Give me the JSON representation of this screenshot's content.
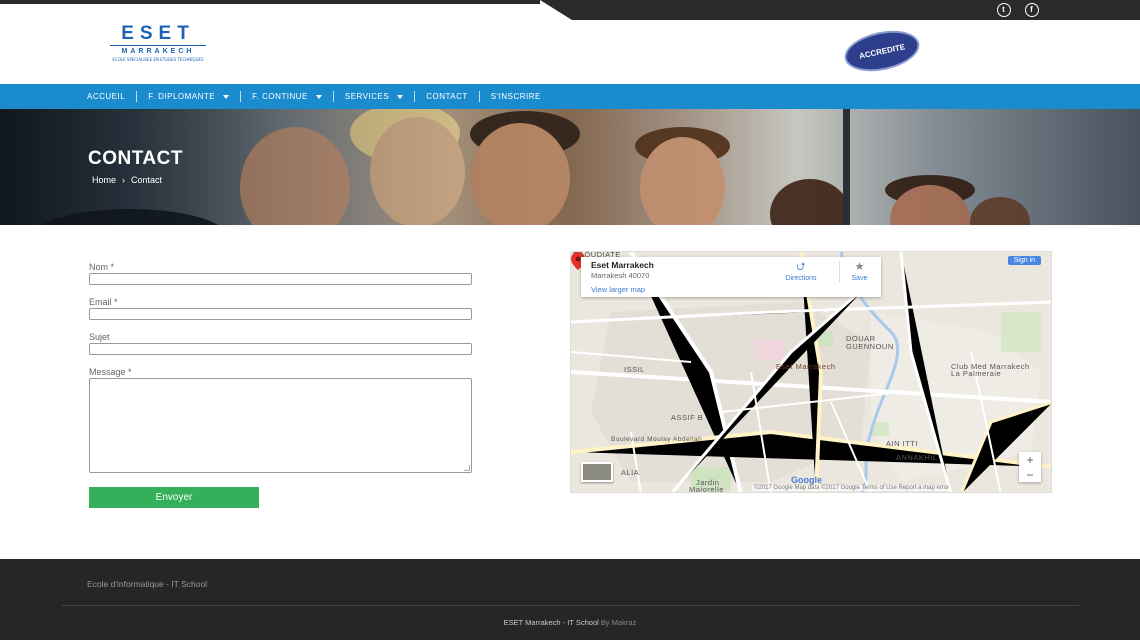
{
  "social": {
    "twitter": "twitter-icon",
    "facebook": "facebook-icon",
    "twitter_glyph": "t",
    "facebook_glyph": "f"
  },
  "header": {
    "logo_title": "ESET",
    "logo_sub": "MARRAKECH",
    "logo_tagline": "ECOLE SPECIALISEE EN ETUDES TECHNIQUES",
    "badge_text": "ACCREDITE"
  },
  "nav": {
    "items": [
      {
        "label": "ACCUEIL"
      },
      {
        "label": "F. DIPLOMANTE"
      },
      {
        "label": "F. CONTINUE"
      },
      {
        "label": "SERVICES"
      },
      {
        "label": "CONTACT"
      },
      {
        "label": "S'INSCRIRE"
      }
    ]
  },
  "hero": {
    "title": "CONTACT",
    "breadcrumb": {
      "home": "Home",
      "sep": "›",
      "current": "Contact"
    }
  },
  "form": {
    "nom_label": "Nom *",
    "email_label": "Email *",
    "sujet_label": "Sujet",
    "message_label": "Message *",
    "submit_label": "Envoyer"
  },
  "map": {
    "place_name": "Eset Marrakech",
    "address": "Marrakesh 40070",
    "larger_map": "View larger map",
    "directions": "Directions",
    "save": "Save",
    "sign_in": "Sign in",
    "zoom_in": "+",
    "zoom_out": "−",
    "attribution": "©2017 Google   Map data ©2017 Google   Terms of Use   Report a map error",
    "google": "Google",
    "labels": {
      "douar": "DOUAR",
      "guennoun": "GUENNOUN",
      "issil": "ISSIL",
      "assif": "ASSIF B",
      "ain_itti": "AIN ITTI",
      "annakhil": "ANNAKHIL",
      "club_med": "Club Med Marrakech",
      "palmeraie": "La Palmeraie",
      "moulay": "Boulevard Moulay Abdellah",
      "jardin": "Jardin",
      "majorelle": "Majorelle",
      "alia": "ALIA",
      "daoudiate": "DAOUDIATE",
      "eset_marker": "Eset Marrakech"
    }
  },
  "footer": {
    "tagline": "Ecole d'informatique - IT School",
    "copyright": "ESET Marrakech - IT School",
    "by": "By Makraz"
  }
}
